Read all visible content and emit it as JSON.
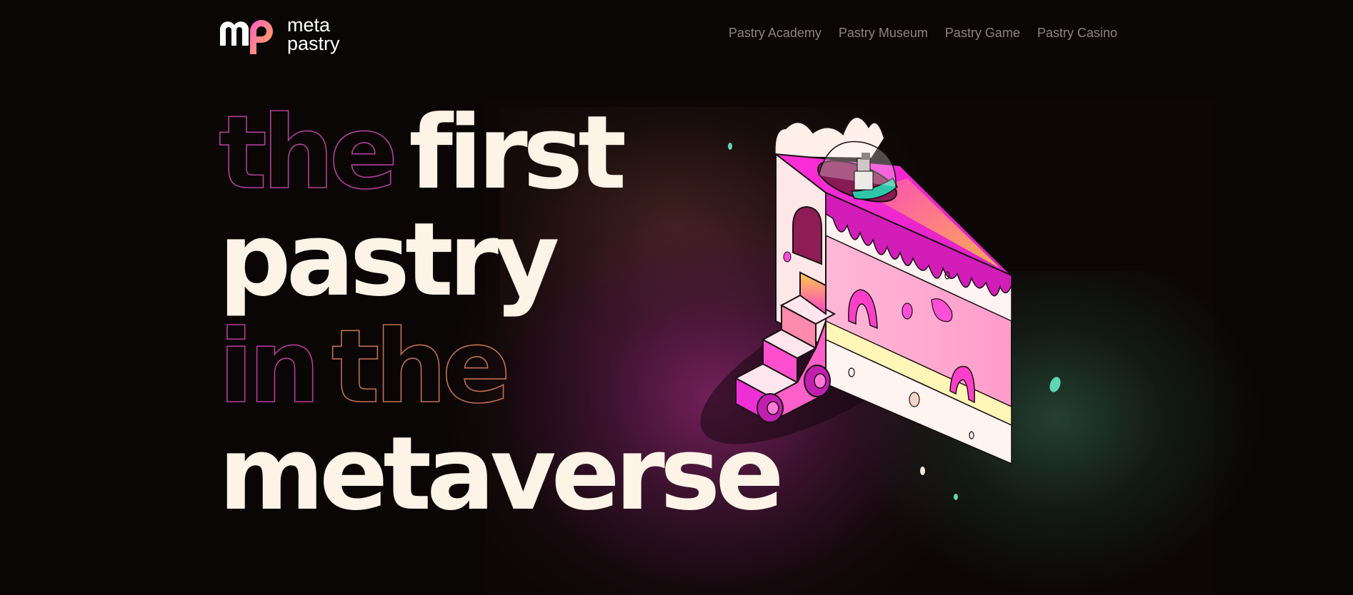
{
  "brand": {
    "logo_line1": "meta",
    "logo_line2": "pastry",
    "logo_icon": "mp-monogram-icon",
    "colors": {
      "pink": "#ff4fb0",
      "orange": "#ffb347"
    }
  },
  "nav": {
    "items": [
      {
        "label": "Pastry Academy"
      },
      {
        "label": "Pastry Museum"
      },
      {
        "label": "Pastry Game"
      },
      {
        "label": "Pastry Casino"
      }
    ]
  },
  "hero": {
    "line1_outline": "the",
    "line1_solid": "first",
    "line2_solid": "pastry",
    "line3_outline_a": "in",
    "line3_outline_b": "the",
    "line4_solid": "metaverse"
  },
  "colors": {
    "background": "#0a0605",
    "headline": "#fdf3e7",
    "nav_text": "#8a8480",
    "accent_magenta": "#e52fd0",
    "accent_teal": "#5fd6b5"
  }
}
